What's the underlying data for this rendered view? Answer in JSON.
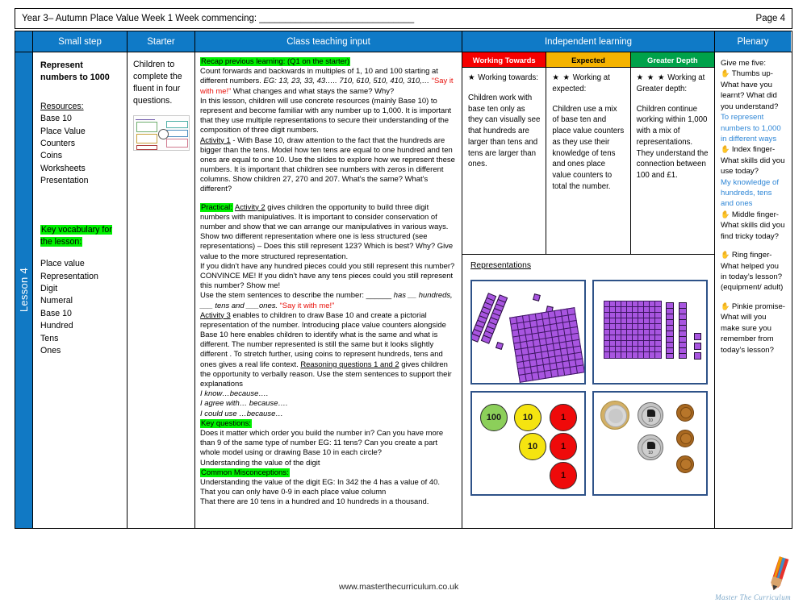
{
  "header": {
    "title": "Year 3– Autumn Place Value Week 1 Week commencing: ______________________________",
    "page_label": "Page 4"
  },
  "columns": {
    "small_step": "Small step",
    "starter": "Starter",
    "class_teaching_input": "Class teaching input",
    "independent_learning": "Independent learning",
    "plenary": "Plenary"
  },
  "lesson_tab": "Lesson 4",
  "small_step": {
    "title": "Represent numbers to 1000",
    "resources_heading": "Resources:",
    "resources": [
      "Base 10",
      "Place Value Counters",
      "Coins",
      "Worksheets",
      "Presentation"
    ],
    "vocab_heading": "Key vocabulary for the lesson:",
    "vocabulary": [
      "Place value",
      "Representation",
      "Digit",
      "Numeral",
      "Base 10",
      "Hundred",
      "Tens",
      "Ones"
    ]
  },
  "starter": {
    "text": "Children to complete the fluent in four questions.",
    "thumbnail_name": "fluent-in-four-slide-thumbnail"
  },
  "teaching": {
    "recap_heading": "Recap previous learning: (Q1 on the starter)",
    "recap_line1": "Count forwards and backwards in multiples of 1, 10 and 100 starting at different numbers. ",
    "recap_eg": "EG:  13, 23, 33, 43…..  710, 610, 510, 410, 310,… ",
    "recap_say": "“Say it with me!”",
    "recap_line2": " What changes and what stays the same?  Why?",
    "intro": "In this lesson, children will use concrete resources (mainly Base 10) to represent and become familiar with any number up to 1,000.  It is important that they use multiple representations to secure their understanding of the composition of three digit numbers.",
    "activity1_label": "Activity 1",
    "activity1_text": " -  With Base 10, draw attention to the fact that the hundreds are bigger than the tens.  Model how ten tens are equal to one hundred and ten ones are equal to one 10.   Use the slides to  explore how we represent these numbers.  It is important that children see numbers with zeros in different columns.  Show children 27, 270 and 207.  What's the same? What's different?",
    "practical_label": "Practical:",
    "activity2_label": "Activity 2",
    "activity2_text": " gives children the opportunity to build three digit numbers with manipulatives.    It is important to consider conservation of number and show that we can arrange our manipulatives in various ways. Show two different representation where one is less structured (see representations) – Does this still represent 123?  Which is best? Why?  Give value to the more structured representation.",
    "convince": "If you didn’t have any hundred pieces could you still represent this number?  CONVINCE ME! If you didn’t have any tens pieces could you still represent this number? Show me!",
    "stem_intro": "Use the stem sentences to describe the number: ______ ",
    "stem_italic1": "has __ hundreds, ___ tens and ___ones.",
    "stem_say": " “Say it with me!”",
    "activity3_label": "Activity 3",
    "activity3_text": " enables to children to draw Base 10 and create a pictorial representation of the number.  Introducing  place value counters alongside Base 10 here enables children to identify what is the same and what is different.  The number represented is still the same but it looks slightly different . To stretch further, using coins to represent hundreds, tens and ones gives a real life context.  ",
    "reasoning_label": "Reasoning questions 1 and 2",
    "reasoning_text": " gives children the opportunity to verbally reason. Use the stem sentences to support their explanations",
    "stems": [
      "I know…because….",
      "I agree with… because….",
      " I could use …because…"
    ],
    "key_questions_heading": "Key questions:",
    "key_questions": [
      "Does it matter which order you build the number in?  Can you have more than 9 of the same type of number EG: 11 tens?  Can you create a part whole model using or drawing Base 10 in each circle?",
      "Understanding the value of the digit"
    ],
    "misconceptions_heading": "Common Misconceptions:",
    "misconceptions": [
      "Understanding the value of the digit  EG:  In 342  the 4  has a value of 40.",
      "That you can only have 0-9 in each place value column",
      "That there are 10 tens in a hundred and 10 hundreds in a thousand."
    ]
  },
  "independent": {
    "levels": [
      {
        "label": "Working Towards",
        "color": "#f50000",
        "stars": "★",
        "star_count": 1,
        "heading": " Working towards:",
        "body": " Children work with base ten only as they can visually see that hundreds are larger than tens and tens are larger than ones."
      },
      {
        "label": "Expected",
        "color": "#f5b300",
        "stars": "★ ★",
        "star_count": 2,
        "heading": " Working at expected:",
        "body": "Children use a mix of base ten and place value counters as they use their knowledge of tens and ones place value counters to total the number."
      },
      {
        "label": "Greater Depth",
        "color": "#00a24a",
        "stars": "★ ★ ★",
        "star_count": 3,
        "heading": " Working at Greater depth:",
        "body": "Children continue working within 1,000 with a mix of representations. They understand the connection between 100 and £1."
      }
    ],
    "representations_title": "Representations",
    "panels": [
      {
        "name": "unstructured-base-ten",
        "description": "Two ten-rods, three loose unit cubes and one hundred-flat arranged at angles"
      },
      {
        "name": "structured-base-ten",
        "description": "One hundred-flat, two ten-rods and three unit cubes in a row"
      },
      {
        "name": "place-value-counters",
        "counters": [
          {
            "value": "100",
            "color": "#8ccf5a",
            "count": 1
          },
          {
            "value": "10",
            "color": "#f5e410",
            "count": 2
          },
          {
            "value": "1",
            "color": "#ef0a0a",
            "count": 3
          }
        ]
      },
      {
        "name": "coins",
        "coins": [
          {
            "value": "£1",
            "count": 1
          },
          {
            "value": "10p",
            "count": 2
          },
          {
            "value": "1p",
            "count": 3
          }
        ]
      }
    ]
  },
  "plenary": {
    "intro": "Give me five:",
    "items": [
      {
        "icon": "hand-icon",
        "prompt": " Thumbs up- What have you learnt? What did you understand?",
        "answer": "To represent numbers to 1,000 in different ways"
      },
      {
        "icon": "hand-icon",
        "prompt": " Index finger- What skills did you use today?",
        "answer": "My knowledge of hundreds, tens and ones"
      },
      {
        "icon": "hand-icon",
        "prompt": " Middle finger- What skills did you find tricky today?",
        "answer": ""
      },
      {
        "icon": "hand-icon",
        "prompt": " Ring finger- What helped you in today’s lesson? (equipment/ adult)",
        "answer": ""
      },
      {
        "icon": "hand-icon",
        "prompt": " Pinkie promise- What will you make sure you remember from today’s lesson?",
        "answer": ""
      }
    ]
  },
  "footer": {
    "url": "www.masterthecurriculum.co.uk",
    "logo_text": "Master The Curriculum"
  }
}
